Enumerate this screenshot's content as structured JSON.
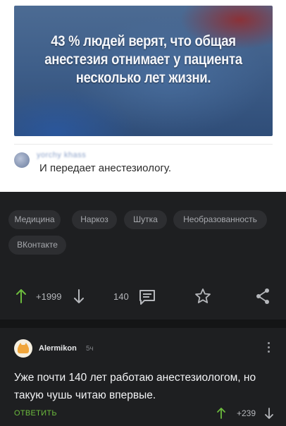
{
  "post": {
    "image_text": "43 % людей верят, что общая анестезия отнимает у пациента несколько лет жизни.",
    "quoted_comment": {
      "author": "yorchy khass",
      "text": "И передает анестезиологу."
    }
  },
  "tags": [
    "Медицина",
    "Наркоз",
    "Шутка",
    "Необразованность",
    "ВКонтакте"
  ],
  "actions": {
    "rating": "+1999",
    "comments_count": "140"
  },
  "comment": {
    "author": "Alermikon",
    "time": "5ч",
    "text": "Уже почти 140 лет работаю анестезиологом, но такую чушь читаю впервые.",
    "reply_label": "ОТВЕТИТЬ",
    "rating": "+239"
  },
  "colors": {
    "background": "#1e1f21",
    "accent_green": "#6cbb3d",
    "tag_background": "#2d2e31"
  },
  "icons": [
    "arrow-up-icon",
    "arrow-down-icon",
    "comment-icon",
    "star-icon",
    "share-icon",
    "more-icon"
  ]
}
